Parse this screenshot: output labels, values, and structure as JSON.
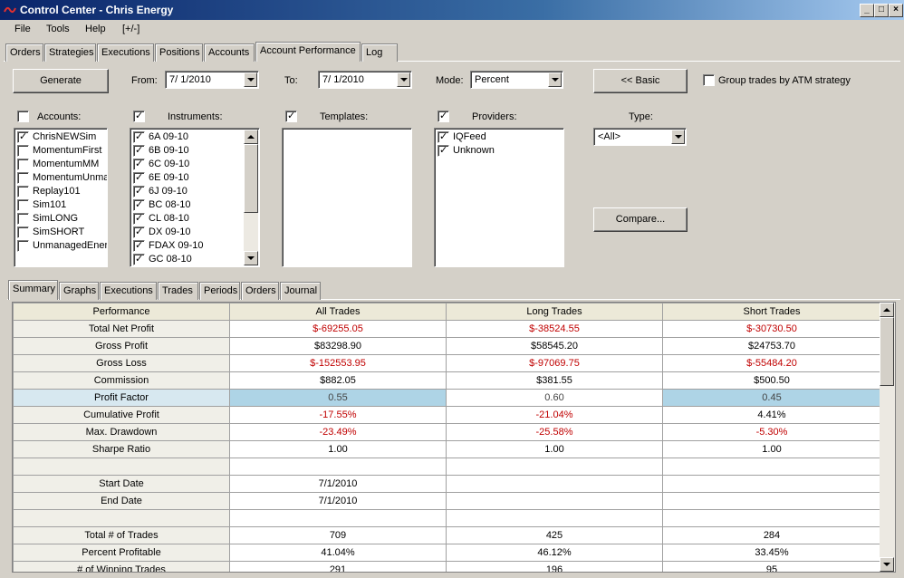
{
  "window": {
    "title": "Control Center - Chris Energy"
  },
  "menu": [
    "File",
    "Tools",
    "Help",
    "[+/-]"
  ],
  "main_tabs": [
    "Orders",
    "Strategies",
    "Executions",
    "Positions",
    "Accounts",
    "Account Performance",
    "Log"
  ],
  "controls": {
    "generate": "Generate",
    "from_label": "From:",
    "from_value": "7/ 1/2010",
    "to_label": "To:",
    "to_value": "7/ 1/2010",
    "mode_label": "Mode:",
    "mode_value": "Percent",
    "basic": "<< Basic",
    "group_atm": "Group trades by ATM strategy",
    "compare": "Compare...",
    "type_label": "Type:",
    "type_value": "<All>"
  },
  "accounts": {
    "label": "Accounts:",
    "items": [
      {
        "name": "ChrisNEWSim",
        "checked": true
      },
      {
        "name": "MomentumFirst",
        "checked": false
      },
      {
        "name": "MomentumMM",
        "checked": false
      },
      {
        "name": "MomentumUnmar",
        "checked": false
      },
      {
        "name": "Replay101",
        "checked": false
      },
      {
        "name": "Sim101",
        "checked": false
      },
      {
        "name": "SimLONG",
        "checked": false
      },
      {
        "name": "SimSHORT",
        "checked": false
      },
      {
        "name": "UnmanagedEner",
        "checked": false
      }
    ]
  },
  "instruments": {
    "label": "Instruments:",
    "items": [
      {
        "name": "6A 09-10",
        "checked": true
      },
      {
        "name": "6B 09-10",
        "checked": true
      },
      {
        "name": "6C 09-10",
        "checked": true
      },
      {
        "name": "6E 09-10",
        "checked": true
      },
      {
        "name": "6J 09-10",
        "checked": true
      },
      {
        "name": "BC 08-10",
        "checked": true
      },
      {
        "name": "CL 08-10",
        "checked": true
      },
      {
        "name": "DX 09-10",
        "checked": true
      },
      {
        "name": "FDAX 09-10",
        "checked": true
      },
      {
        "name": "GC 08-10",
        "checked": true
      }
    ]
  },
  "templates": {
    "label": "Templates:",
    "items": []
  },
  "providers": {
    "label": "Providers:",
    "items": [
      {
        "name": "IQFeed",
        "checked": true
      },
      {
        "name": "Unknown",
        "checked": true
      }
    ]
  },
  "sub_tabs": [
    "Summary",
    "Graphs",
    "Executions",
    "Trades",
    "Periods",
    "Orders",
    "Journal"
  ],
  "perf_table": {
    "headers": [
      "Performance",
      "All Trades",
      "Long Trades",
      "Short Trades"
    ],
    "rows": [
      {
        "label": "Total Net Profit",
        "all": "$-69255.05",
        "long": "$-38524.55",
        "short": "$-30730.50",
        "neg": [
          true,
          true,
          true
        ]
      },
      {
        "label": "Gross Profit",
        "all": "$83298.90",
        "long": "$58545.20",
        "short": "$24753.70",
        "neg": [
          false,
          false,
          false
        ]
      },
      {
        "label": "Gross Loss",
        "all": "$-152553.95",
        "long": "$-97069.75",
        "short": "$-55484.20",
        "neg": [
          true,
          true,
          true
        ]
      },
      {
        "label": "Commission",
        "all": "$882.05",
        "long": "$381.55",
        "short": "$500.50",
        "neg": [
          false,
          false,
          false
        ]
      },
      {
        "label": "Profit Factor",
        "all": "0.55",
        "long": "0.60",
        "short": "0.45",
        "neg": [
          false,
          false,
          false
        ],
        "selected": true
      },
      {
        "label": "Cumulative Profit",
        "all": "-17.55%",
        "long": "-21.04%",
        "short": "4.41%",
        "neg": [
          true,
          true,
          false
        ]
      },
      {
        "label": "Max. Drawdown",
        "all": "-23.49%",
        "long": "-25.58%",
        "short": "-5.30%",
        "neg": [
          true,
          true,
          true
        ]
      },
      {
        "label": "Sharpe Ratio",
        "all": "1.00",
        "long": "1.00",
        "short": "1.00",
        "neg": [
          false,
          false,
          false
        ]
      },
      {
        "label": "",
        "all": "",
        "long": "",
        "short": "",
        "neg": [
          false,
          false,
          false
        ]
      },
      {
        "label": "Start Date",
        "all": "7/1/2010",
        "long": "",
        "short": "",
        "neg": [
          false,
          false,
          false
        ]
      },
      {
        "label": "End Date",
        "all": "7/1/2010",
        "long": "",
        "short": "",
        "neg": [
          false,
          false,
          false
        ]
      },
      {
        "label": "",
        "all": "",
        "long": "",
        "short": "",
        "neg": [
          false,
          false,
          false
        ]
      },
      {
        "label": "Total # of Trades",
        "all": "709",
        "long": "425",
        "short": "284",
        "neg": [
          false,
          false,
          false
        ]
      },
      {
        "label": "Percent Profitable",
        "all": "41.04%",
        "long": "46.12%",
        "short": "33.45%",
        "neg": [
          false,
          false,
          false
        ]
      },
      {
        "label": "# of Winning Trades",
        "all": "291",
        "long": "196",
        "short": "95",
        "neg": [
          false,
          false,
          false
        ]
      }
    ]
  },
  "colors": {
    "negative": "#c00000",
    "selected_row": "#aed4e6",
    "title_bar": "#0a246a"
  }
}
